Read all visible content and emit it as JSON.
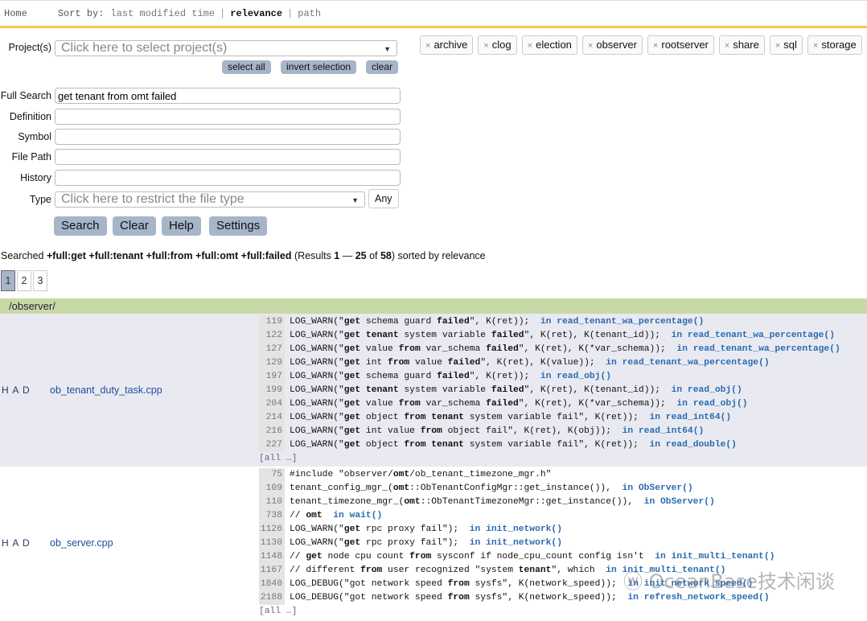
{
  "topbar": {
    "home": "Home",
    "sort_label": "Sort by:",
    "sort_options": [
      "last modified time",
      "relevance",
      "path"
    ]
  },
  "form": {
    "projects_label": "Project(s)",
    "projects_placeholder": "Click here to select project(s)",
    "select_all": "select all",
    "invert_selection": "invert selection",
    "clear_small": "clear",
    "tags": [
      "archive",
      "clog",
      "election",
      "observer",
      "rootserver",
      "share",
      "sql",
      "storage"
    ],
    "full_search_label": "Full Search",
    "full_search_value": "get tenant from omt failed",
    "definition_label": "Definition",
    "symbol_label": "Symbol",
    "file_path_label": "File Path",
    "history_label": "History",
    "type_label": "Type",
    "type_placeholder": "Click here to restrict the file type",
    "any": "Any",
    "buttons": [
      "Search",
      "Clear",
      "Help",
      "Settings"
    ]
  },
  "summary": {
    "prefix": "Searched ",
    "query": "+full:get +full:tenant +full:from +full:omt +full:failed",
    "r1": " (Results ",
    "from": "1",
    "dash": " — ",
    "to": "25",
    "of": " of ",
    "total": "58",
    "r2": ") sorted by relevance"
  },
  "pages": [
    "1",
    "2",
    "3"
  ],
  "directory": "/observer/",
  "results": [
    {
      "had": "H A D",
      "file": "ob_tenant_duty_task.cpp",
      "more": "[all …]",
      "lines": [
        {
          "n": "119",
          "p": [
            [
              "LOG_WARN(\"",
              0
            ],
            [
              "get",
              1
            ],
            [
              " schema guard ",
              0
            ],
            [
              "failed",
              1
            ],
            [
              "\", K(ret));  ",
              0
            ]
          ],
          "fn": "in read_tenant_wa_percentage()"
        },
        {
          "n": "122",
          "p": [
            [
              "LOG_WARN(\"",
              0
            ],
            [
              "get",
              1
            ],
            [
              " ",
              0
            ],
            [
              "tenant",
              1
            ],
            [
              " system variable ",
              0
            ],
            [
              "failed",
              1
            ],
            [
              "\", K(ret), K(tenant_id));  ",
              0
            ]
          ],
          "fn": "in read_tenant_wa_percentage()"
        },
        {
          "n": "127",
          "p": [
            [
              "LOG_WARN(\"",
              0
            ],
            [
              "get",
              1
            ],
            [
              " value ",
              0
            ],
            [
              "from",
              1
            ],
            [
              " var_schema ",
              0
            ],
            [
              "failed",
              1
            ],
            [
              "\", K(ret), K(*var_schema));  ",
              0
            ]
          ],
          "fn": "in read_tenant_wa_percentage()"
        },
        {
          "n": "129",
          "p": [
            [
              "LOG_WARN(\"",
              0
            ],
            [
              "get",
              1
            ],
            [
              " int ",
              0
            ],
            [
              "from",
              1
            ],
            [
              " value ",
              0
            ],
            [
              "failed",
              1
            ],
            [
              "\", K(ret), K(value));  ",
              0
            ]
          ],
          "fn": "in read_tenant_wa_percentage()"
        },
        {
          "n": "197",
          "p": [
            [
              "LOG_WARN(\"",
              0
            ],
            [
              "get",
              1
            ],
            [
              " schema guard ",
              0
            ],
            [
              "failed",
              1
            ],
            [
              "\", K(ret));  ",
              0
            ]
          ],
          "fn": "in read_obj()"
        },
        {
          "n": "199",
          "p": [
            [
              "LOG_WARN(\"",
              0
            ],
            [
              "get",
              1
            ],
            [
              " ",
              0
            ],
            [
              "tenant",
              1
            ],
            [
              " system variable ",
              0
            ],
            [
              "failed",
              1
            ],
            [
              "\", K(ret), K(tenant_id));  ",
              0
            ]
          ],
          "fn": "in read_obj()"
        },
        {
          "n": "204",
          "p": [
            [
              "LOG_WARN(\"",
              0
            ],
            [
              "get",
              1
            ],
            [
              " value ",
              0
            ],
            [
              "from",
              1
            ],
            [
              " var_schema ",
              0
            ],
            [
              "failed",
              1
            ],
            [
              "\", K(ret), K(*var_schema));  ",
              0
            ]
          ],
          "fn": "in read_obj()"
        },
        {
          "n": "214",
          "p": [
            [
              "LOG_WARN(\"",
              0
            ],
            [
              "get",
              1
            ],
            [
              " object ",
              0
            ],
            [
              "from",
              1
            ],
            [
              " ",
              0
            ],
            [
              "tenant",
              1
            ],
            [
              " system variable fail\", K(ret));  ",
              0
            ]
          ],
          "fn": "in read_int64()"
        },
        {
          "n": "216",
          "p": [
            [
              "LOG_WARN(\"",
              0
            ],
            [
              "get",
              1
            ],
            [
              " int value ",
              0
            ],
            [
              "from",
              1
            ],
            [
              " object fail\", K(ret), K(obj));  ",
              0
            ]
          ],
          "fn": "in read_int64()"
        },
        {
          "n": "227",
          "p": [
            [
              "LOG_WARN(\"",
              0
            ],
            [
              "get",
              1
            ],
            [
              " object ",
              0
            ],
            [
              "from",
              1
            ],
            [
              " ",
              0
            ],
            [
              "tenant",
              1
            ],
            [
              " system variable fail\", K(ret));  ",
              0
            ]
          ],
          "fn": "in read_double()"
        }
      ]
    },
    {
      "had": "H A D",
      "file": "ob_server.cpp",
      "more": "[all …]",
      "lines": [
        {
          "n": "75",
          "p": [
            [
              "#include \"observer/",
              0
            ],
            [
              "omt",
              1
            ],
            [
              "/ob_tenant_timezone_mgr.h\"",
              0
            ]
          ],
          "fn": ""
        },
        {
          "n": "109",
          "p": [
            [
              "tenant_config_mgr_(",
              0
            ],
            [
              "omt",
              1
            ],
            [
              "::ObTenantConfigMgr::get_instance()),  ",
              0
            ]
          ],
          "fn": "in ObServer()"
        },
        {
          "n": "110",
          "p": [
            [
              "tenant_timezone_mgr_(",
              0
            ],
            [
              "omt",
              1
            ],
            [
              "::ObTenantTimezoneMgr::get_instance()),  ",
              0
            ]
          ],
          "fn": "in ObServer()"
        },
        {
          "n": "738",
          "p": [
            [
              "// ",
              0
            ],
            [
              "omt",
              1
            ],
            [
              "  ",
              0
            ]
          ],
          "fn": "in wait()"
        },
        {
          "n": "1126",
          "p": [
            [
              "LOG_WARN(\"",
              0
            ],
            [
              "get",
              1
            ],
            [
              " rpc proxy fail\");  ",
              0
            ]
          ],
          "fn": "in init_network()"
        },
        {
          "n": "1130",
          "p": [
            [
              "LOG_WARN(\"",
              0
            ],
            [
              "get",
              1
            ],
            [
              " rpc proxy fail\");  ",
              0
            ]
          ],
          "fn": "in init_network()"
        },
        {
          "n": "1148",
          "p": [
            [
              "// ",
              0
            ],
            [
              "get",
              1
            ],
            [
              " node cpu count ",
              0
            ],
            [
              "from",
              1
            ],
            [
              " sysconf if node_cpu_count config isn't  ",
              0
            ]
          ],
          "fn": "in init_multi_tenant()"
        },
        {
          "n": "1167",
          "p": [
            [
              "// different ",
              0
            ],
            [
              "from",
              1
            ],
            [
              " user recognized \"system ",
              0
            ],
            [
              "tenant",
              1
            ],
            [
              "\", which  ",
              0
            ]
          ],
          "fn": "in init_multi_tenant()"
        },
        {
          "n": "1840",
          "p": [
            [
              "LOG_DEBUG(\"got network speed ",
              0
            ],
            [
              "from",
              1
            ],
            [
              " sysfs\", K(network_speed));  ",
              0
            ]
          ],
          "fn": "in init_network_speed()"
        },
        {
          "n": "2188",
          "p": [
            [
              "LOG_DEBUG(\"got network speed ",
              0
            ],
            [
              "from",
              1
            ],
            [
              " sysfs\", K(network_speed));  ",
              0
            ]
          ],
          "fn": "in refresh_network_speed()"
        }
      ]
    }
  ],
  "watermark": "OceanBase技术闲谈",
  "colors": {
    "accent": "#f2c94c",
    "button": "#a7b5c9",
    "dir_bar": "#c8d9a8",
    "row_alt": "#e9eaf1",
    "link": "#2a6bb0"
  }
}
